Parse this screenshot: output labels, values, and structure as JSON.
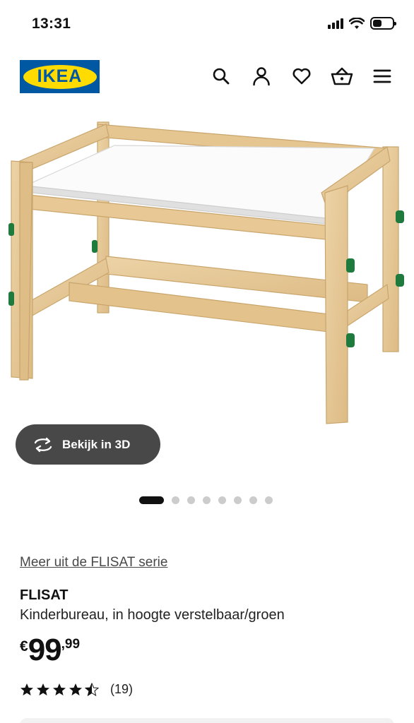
{
  "status_bar": {
    "time": "13:31"
  },
  "header": {
    "logo_text": "IKEA",
    "icons": [
      "search-icon",
      "account-icon",
      "wishlist-heart-icon",
      "shopping-basket-icon",
      "menu-icon"
    ]
  },
  "gallery": {
    "view_3d_label": "Bekijk in 3D",
    "image_count": 8,
    "active_index": 0
  },
  "product": {
    "series_link": "Meer uit de FLISAT serie",
    "name": "FLISAT",
    "description": "Kinderbureau, in hoogte verstelbaar/groen",
    "price_currency": "€",
    "price_integer": "99",
    "price_decimals": ",99",
    "rating_stars": 4.5,
    "rating_count": "(19)"
  },
  "colors": {
    "brand_blue": "#0058a3",
    "brand_yellow": "#ffdb00",
    "button_dark": "#484848"
  }
}
